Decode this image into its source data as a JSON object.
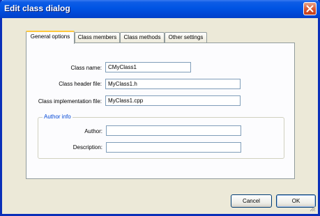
{
  "window": {
    "title": "Edit class dialog"
  },
  "tabs": [
    {
      "label": "General options",
      "active": true
    },
    {
      "label": "Class members",
      "active": false
    },
    {
      "label": "Class methods",
      "active": false
    },
    {
      "label": "Other settings",
      "active": false
    }
  ],
  "form": {
    "class_name": {
      "label": "Class name:",
      "value": "CMyClass1"
    },
    "header_file": {
      "label": "Class header file:",
      "value": "MyClass1.h"
    },
    "impl_file": {
      "label": "Class implementation file:",
      "value": "MyClass1.cpp"
    }
  },
  "author_group": {
    "legend": "Author info",
    "author": {
      "label": "Author:",
      "value": ""
    },
    "description": {
      "label": "Description:",
      "value": ""
    }
  },
  "buttons": {
    "cancel": "Cancel",
    "ok": "OK"
  },
  "colors": {
    "titlebar": "#0054e3",
    "dialog_bg": "#ece9d8",
    "panel_bg": "#fcfcfe",
    "active_tab_accent": "#ffc83c",
    "close_button": "#d5532f",
    "group_legend": "#0046d5"
  },
  "icons": {
    "close": "close-icon",
    "resize": "resize-grip-icon"
  }
}
